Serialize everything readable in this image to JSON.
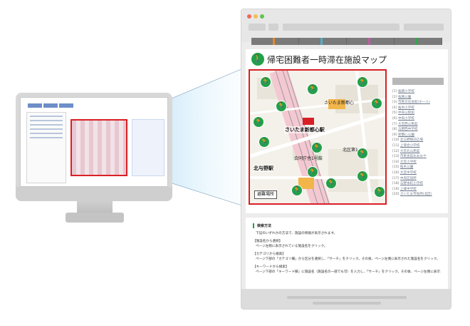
{
  "page": {
    "title": "帰宅困難者一時滞在施設マップ",
    "logo_icon": "walking-person-icon"
  },
  "nav": {
    "accent_colors": [
      "#e8862c",
      "#4fb0c9",
      "#c45aa8",
      "#2ea84a"
    ]
  },
  "map": {
    "labels": {
      "station_main": "さいたま新都心駅",
      "station_north": "北与野駅",
      "label_a": "さいたま新都心",
      "label_b": "合同庁舎1号館",
      "label_c": "北区第1"
    },
    "legend": "避難場所",
    "pin_icon": "evacuation-person-icon",
    "border_color": "#d91f26"
  },
  "sidebar": {
    "items": [
      {
        "no": "[1]",
        "text": "桜路小学校"
      },
      {
        "no": "[2]",
        "text": "桜路公園"
      },
      {
        "no": "[3]",
        "text": "市民文化会館(ホール)"
      },
      {
        "no": "[4]",
        "text": "桜木小学校"
      },
      {
        "no": "[5]",
        "text": "中央公民館"
      },
      {
        "no": "[6]",
        "text": "中央小学校"
      },
      {
        "no": "[7]",
        "text": "大宮西公民館"
      },
      {
        "no": "[8]",
        "text": "与野西中学校"
      },
      {
        "no": "[9]",
        "text": "新都心公園"
      },
      {
        "no": "[10]",
        "text": "北与野駅前広場"
      },
      {
        "no": "[11]",
        "text": "上落合小学校"
      },
      {
        "no": "[12]",
        "text": "大宮北公民館"
      },
      {
        "no": "[13]",
        "text": "市民会館おおみや"
      },
      {
        "no": "[14]",
        "text": "大宮小学校"
      },
      {
        "no": "[15]",
        "text": "桜木公園"
      },
      {
        "no": "[16]",
        "text": "大宮中学校"
      },
      {
        "no": "[17]",
        "text": "中央区役所"
      },
      {
        "no": "[18]",
        "text": "与野本町小学校"
      },
      {
        "no": "[19]",
        "text": "上峰中学校"
      },
      {
        "no": "[20]",
        "text": "さいたま市役所(北区)"
      }
    ]
  },
  "howto": {
    "title": "検索方法",
    "intro": "下記のいずれかの方法で、施設の情報が表示されます。",
    "sections": [
      {
        "heading": "【施設名から選択】",
        "body": "ページ左側に表示されている施設名をクリック。"
      },
      {
        "heading": "【カテゴリから検索】",
        "body": "ページ下部の「カテゴリ欄」から区分を選択し、「サーチ」をクリック。その後、ページ左側に表示された施設名をクリック。"
      },
      {
        "heading": "【キーワードから検索】",
        "body": "ページ下部の「キーワード欄」に施設名（施設名の一部でも可）を入力し、「サーチ」をクリック。その後、ページ左側に表示された施設名をクリック。"
      }
    ]
  }
}
